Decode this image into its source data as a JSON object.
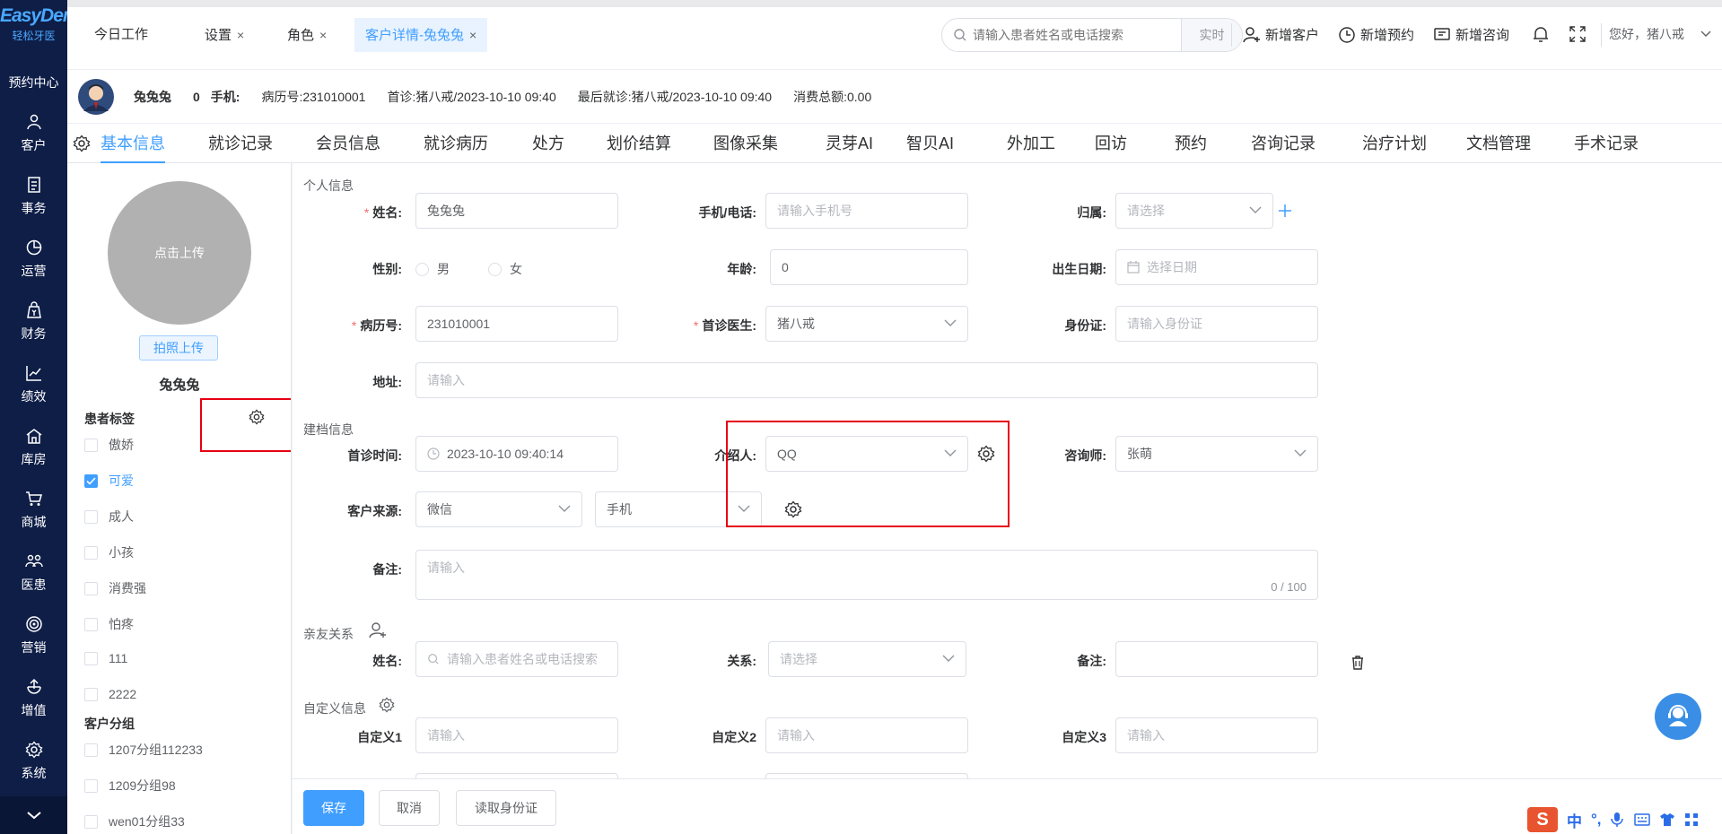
{
  "sidebar": {
    "logo_main": "EasyDent",
    "logo_sub": "轻松牙医",
    "appt_center": "预约中心",
    "items": [
      {
        "label": "客户",
        "icon": "user-icon"
      },
      {
        "label": "事务",
        "icon": "document-icon"
      },
      {
        "label": "运营",
        "icon": "pie-chart-icon"
      },
      {
        "label": "财务",
        "icon": "finance-icon"
      },
      {
        "label": "绩效",
        "icon": "line-chart-icon"
      },
      {
        "label": "库房",
        "icon": "warehouse-icon"
      },
      {
        "label": "商城",
        "icon": "cart-icon"
      },
      {
        "label": "医患",
        "icon": "doctor-patient-icon"
      },
      {
        "label": "营销",
        "icon": "target-icon"
      },
      {
        "label": "增值",
        "icon": "value-added-icon"
      },
      {
        "label": "系统",
        "icon": "gear-icon"
      }
    ]
  },
  "topbar": {
    "tabs": [
      {
        "label": "今日工作",
        "closable": false
      },
      {
        "label": "设置",
        "closable": true
      },
      {
        "label": "角色",
        "closable": true
      },
      {
        "label": "客户详情-兔兔兔",
        "closable": true,
        "active": true
      }
    ],
    "close_glyph": "×",
    "search_placeholder": "请输入患者姓名或电话搜索",
    "search_mode": "实时",
    "new_customer": "新增客户",
    "new_appointment": "新增预约",
    "new_consult": "新增咨询",
    "greeting": "您好，猪八戒"
  },
  "patient": {
    "name": "兔兔兔",
    "count": "0",
    "phone_label": "手机:",
    "record_no": "病历号:231010001",
    "first_visit": "首诊:猪八戒/2023-10-10 09:40",
    "last_visit": "最后就诊:猪八戒/2023-10-10 09:40",
    "total_spend": "消费总额:0.00"
  },
  "main_tabs": [
    "基本信息",
    "就诊记录",
    "会员信息",
    "就诊病历",
    "处方",
    "划价结算",
    "图像采集",
    "灵芽AI",
    "智贝AI",
    "外加工",
    "回访",
    "预约",
    "咨询记录",
    "治疗计划",
    "文档管理",
    "手术记录"
  ],
  "left": {
    "upload": "点击上传",
    "photo_upload": "拍照上传",
    "name": "兔兔兔",
    "tags_title": "患者标签",
    "tags": [
      {
        "label": "傲娇",
        "checked": false
      },
      {
        "label": "可爱",
        "checked": true
      },
      {
        "label": "成人",
        "checked": false
      },
      {
        "label": "小孩",
        "checked": false
      },
      {
        "label": "消费强",
        "checked": false
      },
      {
        "label": "怕疼",
        "checked": false
      },
      {
        "label": "111",
        "checked": false
      },
      {
        "label": "2222",
        "checked": false
      }
    ],
    "groups_title": "客户分组",
    "groups": [
      {
        "label": "1207分组112233",
        "checked": false
      },
      {
        "label": "1209分组98",
        "checked": false
      },
      {
        "label": "wen01分组33",
        "checked": false
      }
    ]
  },
  "form": {
    "personal_title": "个人信息",
    "name_label": "姓名:",
    "name_value": "兔兔兔",
    "phone_label": "手机/电话:",
    "phone_ph": "请输入手机号",
    "belong_label": "归属:",
    "belong_ph": "请选择",
    "gender_label": "性别:",
    "male": "男",
    "female": "女",
    "age_label": "年龄:",
    "age_value": "0",
    "birth_label": "出生日期:",
    "birth_ph": "选择日期",
    "record_label": "病历号:",
    "record_value": "231010001",
    "doctor_label": "首诊医生:",
    "doctor_value": "猪八戒",
    "id_label": "身份证:",
    "id_ph": "请输入身份证",
    "addr_label": "地址:",
    "addr_ph": "请输入",
    "file_title": "建档信息",
    "first_time_label": "首诊时间:",
    "first_time_value": "2023-10-10 09:40:14",
    "referrer_label": "介绍人:",
    "referrer_value": "QQ",
    "consultant_label": "咨询师:",
    "consultant_value": "张萌",
    "source_label": "客户来源:",
    "source_value": "微信",
    "source_sub_value": "手机",
    "note_label": "备注:",
    "note_ph": "请输入",
    "note_count": "0 / 100",
    "relative_title": "亲友关系",
    "rel_name_label": "姓名:",
    "rel_name_ph": "请输入患者姓名或电话搜索",
    "rel_label": "关系:",
    "rel_ph": "请选择",
    "rel_note_label": "备注:",
    "custom_title": "自定义信息",
    "custom1_label": "自定义1",
    "custom2_label": "自定义2",
    "custom3_label": "自定义3",
    "custom_ph": "请输入"
  },
  "bottom": {
    "save": "保存",
    "cancel": "取消",
    "read_id": "读取身份证"
  },
  "ime": {
    "lang": "中",
    "punct": "°,"
  },
  "colors": {
    "primary": "#409eff",
    "sidebar": "#0e1e47",
    "annotation": "#e60012"
  }
}
